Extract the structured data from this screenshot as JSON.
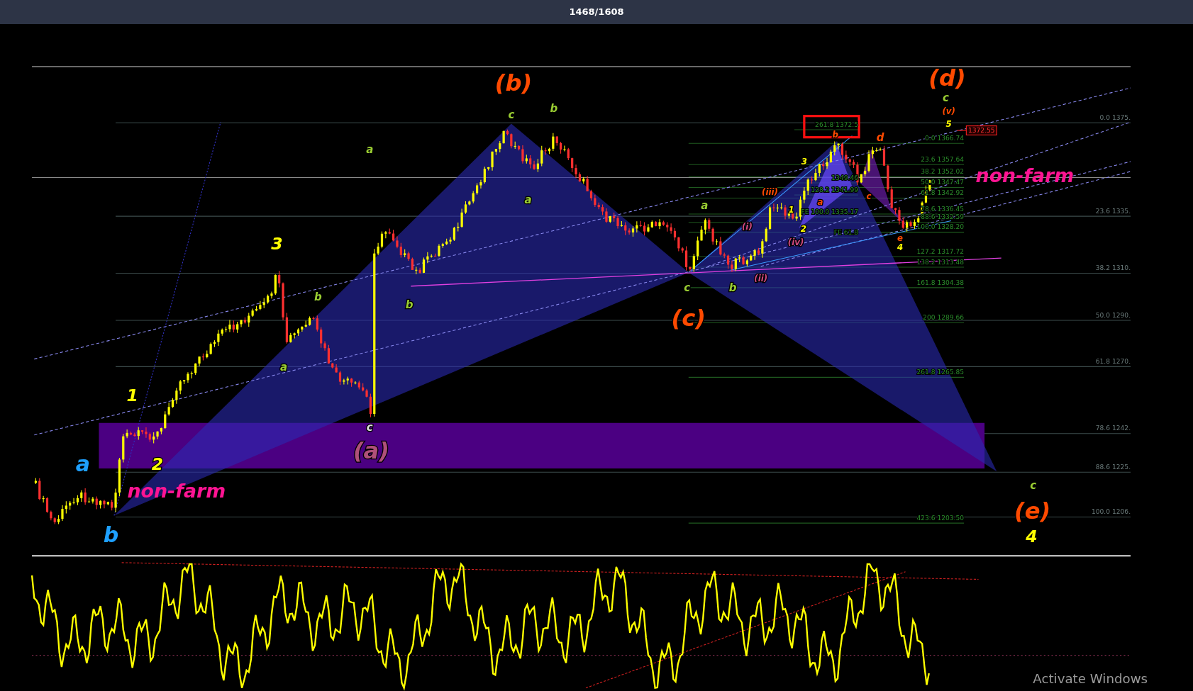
{
  "viewer": {
    "title": "1468/1608"
  },
  "chart": {
    "wave_labels": [
      {
        "text": "(b)",
        "color": "#ff4a00",
        "kind": "major"
      },
      {
        "text": "c",
        "color": "#9acd32",
        "kind": "minor"
      },
      {
        "text": "b",
        "color": "#9acd32",
        "kind": "minor"
      },
      {
        "text": "(d)",
        "color": "#ff4a00",
        "kind": "major"
      },
      {
        "text": "c",
        "color": "#9acd32",
        "kind": "minor"
      },
      {
        "text": "(v)",
        "color": "#ff4a00",
        "kind": "small"
      },
      {
        "text": "5",
        "color": "#ffff00",
        "kind": "small"
      },
      {
        "text": "a",
        "color": "#9acd32",
        "kind": "minor"
      },
      {
        "text": "a",
        "color": "#9acd32",
        "kind": "minor"
      },
      {
        "text": "b",
        "color": "#ff4a00",
        "kind": "small"
      },
      {
        "text": "d",
        "color": "#ff4a00",
        "kind": "minor"
      },
      {
        "text": "3",
        "color": "#ffff00",
        "kind": "small"
      },
      {
        "text": "(iii)",
        "color": "#ff4a00",
        "kind": "small"
      },
      {
        "text": "c",
        "color": "#ff4a00",
        "kind": "small"
      },
      {
        "text": "a",
        "color": "#ff4a00",
        "kind": "small"
      },
      {
        "text": "a",
        "color": "#9acd32",
        "kind": "minor"
      },
      {
        "text": "1",
        "color": "#ffff00",
        "kind": "small"
      },
      {
        "text": "(i)",
        "color": "#d04a80",
        "kind": "small"
      },
      {
        "text": "2",
        "color": "#ffff00",
        "kind": "small"
      },
      {
        "text": "e",
        "color": "#ff4a00",
        "kind": "small"
      },
      {
        "text": "(iv)",
        "color": "#d04a80",
        "kind": "small"
      },
      {
        "text": "4",
        "color": "#ffff00",
        "kind": "small"
      },
      {
        "text": "3",
        "color": "#ffff00",
        "kind": "mid"
      },
      {
        "text": "(ii)",
        "color": "#d04a80",
        "kind": "small"
      },
      {
        "text": "c",
        "color": "#9acd32",
        "kind": "minor"
      },
      {
        "text": "b",
        "color": "#9acd32",
        "kind": "minor"
      },
      {
        "text": "b",
        "color": "#9acd32",
        "kind": "minor"
      },
      {
        "text": "b",
        "color": "#9acd32",
        "kind": "minor"
      },
      {
        "text": "(c)",
        "color": "#ff4a00",
        "kind": "major"
      },
      {
        "text": "a",
        "color": "#9acd32",
        "kind": "minor"
      },
      {
        "text": "1",
        "color": "#ffff00",
        "kind": "mid"
      },
      {
        "text": "c",
        "color": "#dddddd",
        "kind": "minor"
      },
      {
        "text": "(a)",
        "color": "#b0507a",
        "kind": "major"
      },
      {
        "text": "a",
        "color": "#1ea0ff",
        "kind": "big"
      },
      {
        "text": "2",
        "color": "#ffff00",
        "kind": "mid"
      },
      {
        "text": "c",
        "color": "#9acd32",
        "kind": "minor"
      },
      {
        "text": "(e)",
        "color": "#ff4a00",
        "kind": "major"
      },
      {
        "text": "b",
        "color": "#1ea0ff",
        "kind": "big"
      },
      {
        "text": "4",
        "color": "#ffff00",
        "kind": "mid"
      }
    ],
    "event_labels": [
      "non-farm",
      "non-farm"
    ],
    "projection_labels": [
      "261.8 1372.5",
      "1349.46",
      "128.2 1341.99",
      "FE 100.0 1335.17",
      "FE 61.8"
    ],
    "fib_labels": [
      "0.0 1366.74",
      "23.6 1357.64",
      "38.2 1352.02",
      "50.0 1347.47",
      "61.8 1342.92",
      "78.6 1336.45",
      "88.6 1332.59",
      "100.0 1328.20",
      "127.2 1317.72",
      "138.2 1313.48",
      "161.8 1304.38",
      "200 1289.66",
      "261.8 1265.85",
      "423.6 1203.50"
    ],
    "retracement_labels": [
      "0.0 1375.",
      "23.6 1335.",
      "38.2 1310.",
      "50.0 1290.",
      "61.8 1270.",
      "78.6 1242.",
      "88.6 1225.",
      "100.0 1206."
    ],
    "price_tag": "1372.55"
  },
  "os_notice": "Activate Windows"
}
